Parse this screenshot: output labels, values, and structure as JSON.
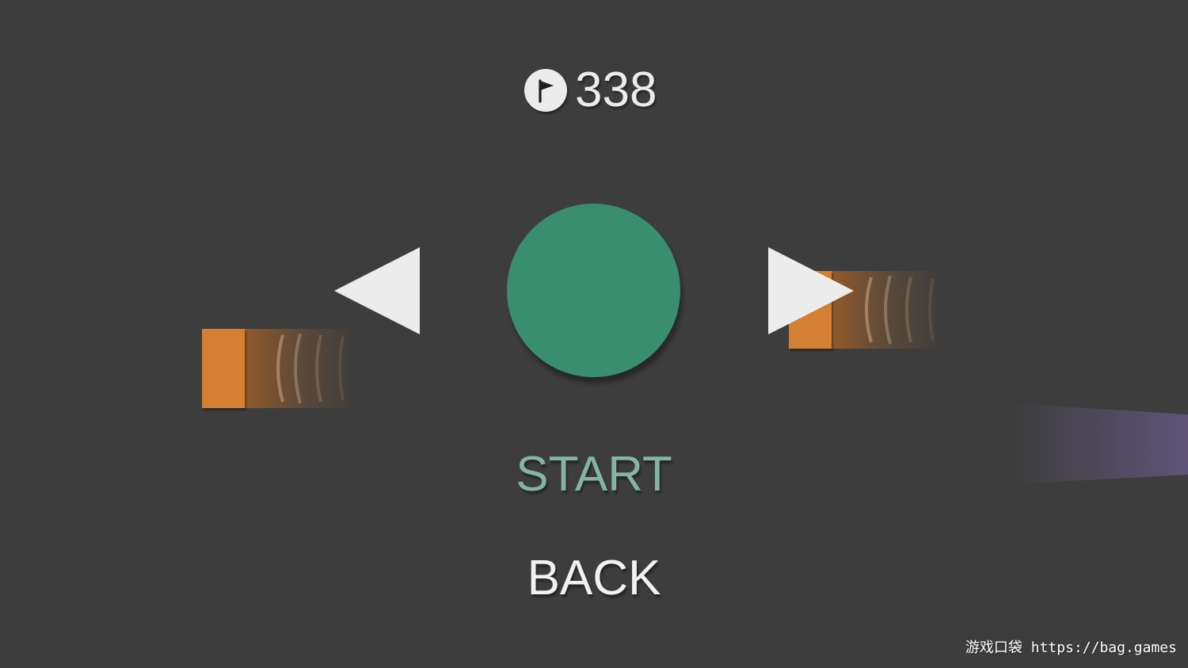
{
  "score": {
    "icon": "flag-icon",
    "value": "338"
  },
  "character": {
    "color": "#3a8e70"
  },
  "navigation": {
    "previous_icon": "triangle-left-icon",
    "next_icon": "triangle-right-icon"
  },
  "menu": {
    "start_label": "START",
    "back_label": "BACK",
    "start_color": "#84b4a4",
    "back_color": "#f2f2f2"
  },
  "colors": {
    "background": "#3d3d3d",
    "block": "#d57f33",
    "beam": "#5f5478",
    "arrow": "#ececec"
  },
  "watermark": "游戏口袋 https://bag.games"
}
